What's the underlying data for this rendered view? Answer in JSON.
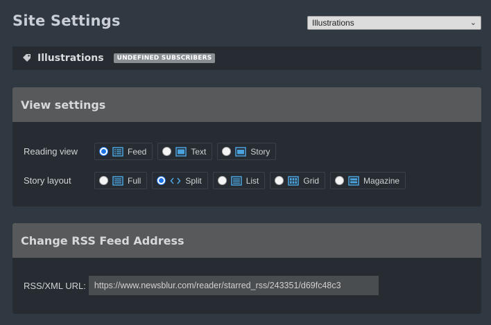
{
  "page": {
    "title": "Site Settings"
  },
  "feed_select": {
    "value": "Illustrations"
  },
  "feed_bar": {
    "name": "Illustrations",
    "badge": "UNDEFINED SUBSCRIBERS"
  },
  "view_settings": {
    "title": "View settings",
    "reading_view": {
      "label": "Reading view",
      "options": [
        {
          "label": "Feed",
          "icon": "feed-icon",
          "checked": true
        },
        {
          "label": "Text",
          "icon": "text-icon",
          "checked": false
        },
        {
          "label": "Story",
          "icon": "story-icon",
          "checked": false
        }
      ]
    },
    "story_layout": {
      "label": "Story layout",
      "options": [
        {
          "label": "Full",
          "icon": "full-layout-icon",
          "checked": false
        },
        {
          "label": "Split",
          "icon": "split-layout-icon",
          "checked": true
        },
        {
          "label": "List",
          "icon": "list-layout-icon",
          "checked": false
        },
        {
          "label": "Grid",
          "icon": "grid-layout-icon",
          "checked": false
        },
        {
          "label": "Magazine",
          "icon": "magazine-layout-icon",
          "checked": false
        }
      ]
    }
  },
  "rss": {
    "title": "Change RSS Feed Address",
    "label": "RSS/XML URL:",
    "value": "https://www.newsblur.com/reader/starred_rss/243351/d69fc48c3"
  },
  "colors": {
    "accent": "#1a73e8",
    "icon_blue": "#4aa3df",
    "background": "#303842",
    "panel": "#262c31",
    "header": "#58595b"
  }
}
